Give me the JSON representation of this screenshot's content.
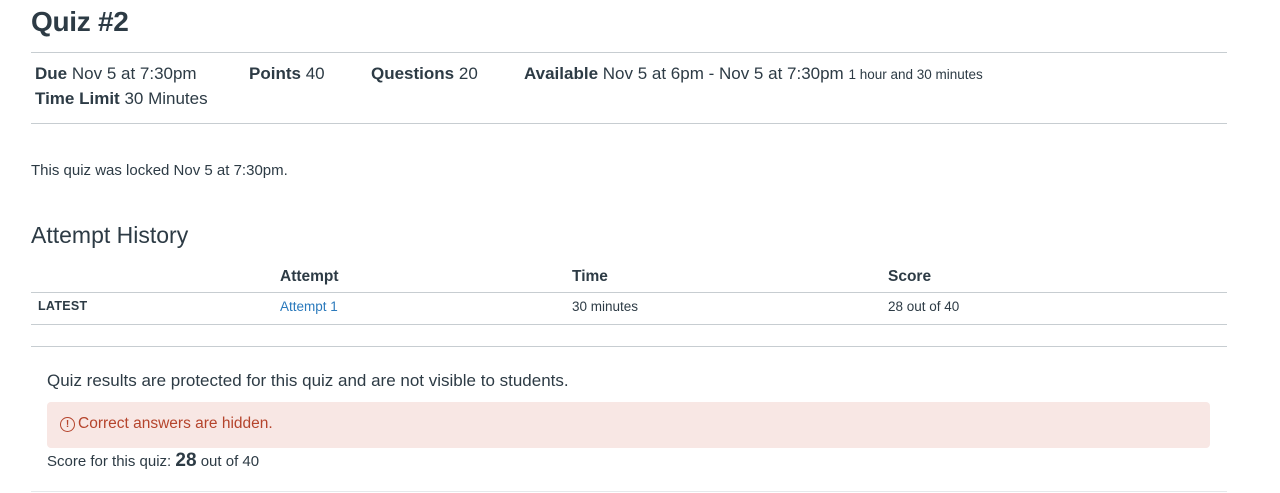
{
  "quiz": {
    "title": "Quiz #2",
    "due_label": "Due",
    "due_value": "Nov 5 at 7:30pm",
    "points_label": "Points",
    "points_value": "40",
    "questions_label": "Questions",
    "questions_value": "20",
    "available_label": "Available",
    "available_value": "Nov 5 at 6pm - Nov 5 at 7:30pm",
    "available_duration": "1 hour and 30 minutes",
    "time_limit_label": "Time Limit",
    "time_limit_value": "30 Minutes",
    "locked_message": "This quiz was locked Nov 5 at 7:30pm."
  },
  "attempt_history": {
    "title": "Attempt History",
    "columns": [
      "Attempt",
      "Time",
      "Score"
    ],
    "rows": [
      {
        "tag": "LATEST",
        "attempt": "Attempt 1",
        "time": "30 minutes",
        "score": "28 out of 40"
      }
    ]
  },
  "results": {
    "protected_message": "Quiz results are protected for this quiz and are not visible to students.",
    "alert_icon": "alert-circle-icon",
    "alert_icon_glyph": "!",
    "alert_text": "Correct answers are hidden.",
    "alert_color": "#b5442c",
    "alert_bg": "#f8e7e4",
    "score_label": "Score for this quiz:",
    "score_value": "28",
    "score_suffix": "out of 40"
  },
  "colors": {
    "text": "#2d3b45",
    "link": "#2b7abc",
    "divider": "#c7cdd1"
  }
}
